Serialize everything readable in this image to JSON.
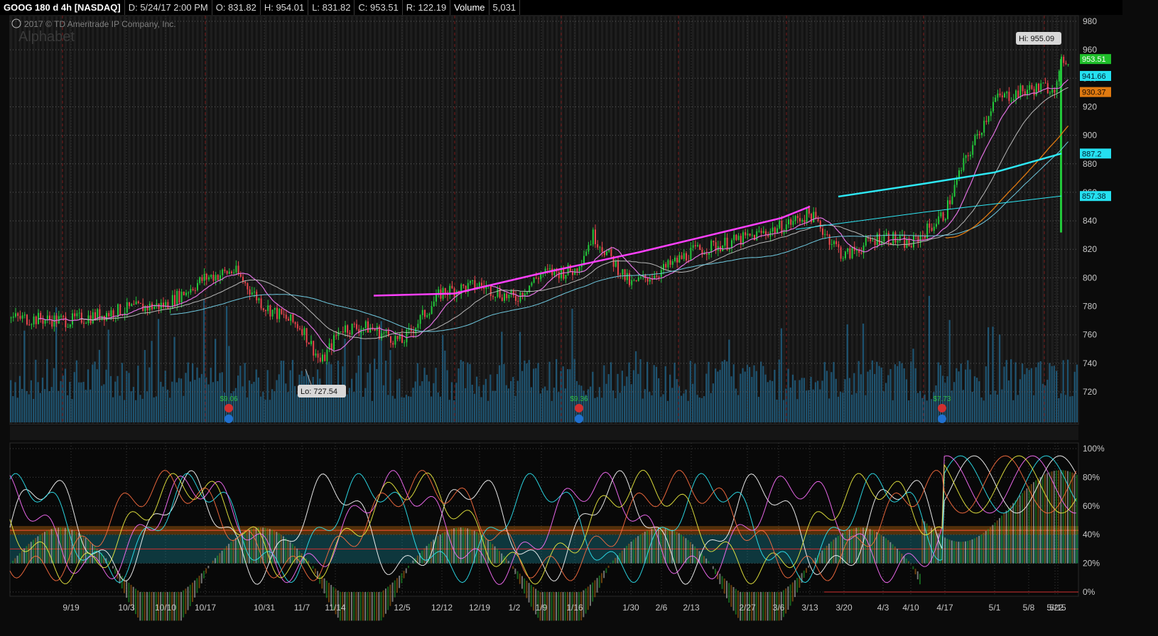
{
  "header": {
    "symbol": "GOOG 180 d 4h [NASDAQ]",
    "date": "D: 5/24/17 2:00 PM",
    "open": "O: 831.82",
    "high": "H: 954.01",
    "low": "L: 831.82",
    "close": "C: 953.51",
    "range": "R: 122.19",
    "volume_label": "Volume",
    "volume_value": "5,031"
  },
  "watermark": {
    "copyright": "2017 © TD Ameritrade IP Company, Inc.",
    "company": "Alphabet"
  },
  "price_axis": {
    "ticks": [
      "980",
      "960",
      "940",
      "920",
      "900",
      "880",
      "860",
      "840",
      "820",
      "800",
      "780",
      "760",
      "740",
      "720"
    ]
  },
  "price_tags": [
    {
      "label": "953.51",
      "value": 953.51,
      "color": "#1fbf2a",
      "text_color": "#ffffff"
    },
    {
      "label": "941.66",
      "value": 941.66,
      "color": "#25e0f0",
      "text_color": "#002030"
    },
    {
      "label": "930.37",
      "value": 930.37,
      "color": "#e07a10",
      "text_color": "#1a0a00"
    },
    {
      "label": "887.2",
      "value": 887.2,
      "color": "#25e0f0",
      "text_color": "#002030"
    },
    {
      "label": "857.38",
      "value": 857.38,
      "color": "#25e0f0",
      "text_color": "#002030"
    }
  ],
  "callouts": {
    "high": "Hi: 955.09",
    "low": "Lo: 727.54"
  },
  "dividends": [
    {
      "amount": "$9.06",
      "date_index": "10/21"
    },
    {
      "amount": "$9.36",
      "date_index": "1/26"
    },
    {
      "amount": "$7.73",
      "date_index": "4/27"
    }
  ],
  "oscillator_axis": {
    "ticks": [
      "100%",
      "80%",
      "60%",
      "40%",
      "20%",
      "0%"
    ]
  },
  "date_axis": {
    "labels": [
      "9/19",
      "10/3",
      "10/10",
      "10/17",
      "10/31",
      "11/7",
      "11/14",
      "12/5",
      "12/12",
      "12/19",
      "1/2",
      "1/9",
      "1/16",
      "1/30",
      "2/6",
      "2/13",
      "2/27",
      "3/6",
      "3/13",
      "3/20",
      "4/3",
      "4/10",
      "4/17",
      "5/1",
      "5/8",
      "5/15",
      "5/22"
    ]
  },
  "colors": {
    "up": "#22c83a",
    "down": "#e8454c",
    "ma_magenta": "#ff40ff",
    "ma_cyan": "#2ee8f5",
    "ma_orange": "#e07a10",
    "ma_gray": "#b8b8b8",
    "volume": "#1f5a7a"
  },
  "chart_data": {
    "type": "candlestick",
    "price_range": [
      710,
      985
    ],
    "oscillator_range": [
      0,
      100
    ],
    "key_points": [
      {
        "x": "9/12",
        "price": 772
      },
      {
        "x": "9/19",
        "price": 770
      },
      {
        "x": "10/3",
        "price": 778
      },
      {
        "x": "10/10",
        "price": 781
      },
      {
        "x": "10/17",
        "price": 800
      },
      {
        "x": "10/24",
        "price": 805
      },
      {
        "x": "10/31",
        "price": 780
      },
      {
        "x": "11/7",
        "price": 765
      },
      {
        "x": "11/14",
        "price": 740
      },
      {
        "x": "11/21",
        "price": 765
      },
      {
        "x": "11/28",
        "price": 765
      },
      {
        "x": "12/5",
        "price": 755
      },
      {
        "x": "12/12",
        "price": 790
      },
      {
        "x": "12/19",
        "price": 795
      },
      {
        "x": "1/2",
        "price": 785
      },
      {
        "x": "1/9",
        "price": 803
      },
      {
        "x": "1/16",
        "price": 805
      },
      {
        "x": "1/23",
        "price": 830
      },
      {
        "x": "1/30",
        "price": 795
      },
      {
        "x": "2/6",
        "price": 805
      },
      {
        "x": "2/13",
        "price": 818
      },
      {
        "x": "2/27",
        "price": 828
      },
      {
        "x": "3/6",
        "price": 835
      },
      {
        "x": "3/13",
        "price": 845
      },
      {
        "x": "3/20",
        "price": 815
      },
      {
        "x": "4/3",
        "price": 830
      },
      {
        "x": "4/10",
        "price": 823
      },
      {
        "x": "4/17",
        "price": 845
      },
      {
        "x": "4/24",
        "price": 875
      },
      {
        "x": "5/1",
        "price": 925
      },
      {
        "x": "5/8",
        "price": 932
      },
      {
        "x": "5/15",
        "price": 935
      },
      {
        "x": "5/22",
        "price": 953.51
      }
    ]
  }
}
